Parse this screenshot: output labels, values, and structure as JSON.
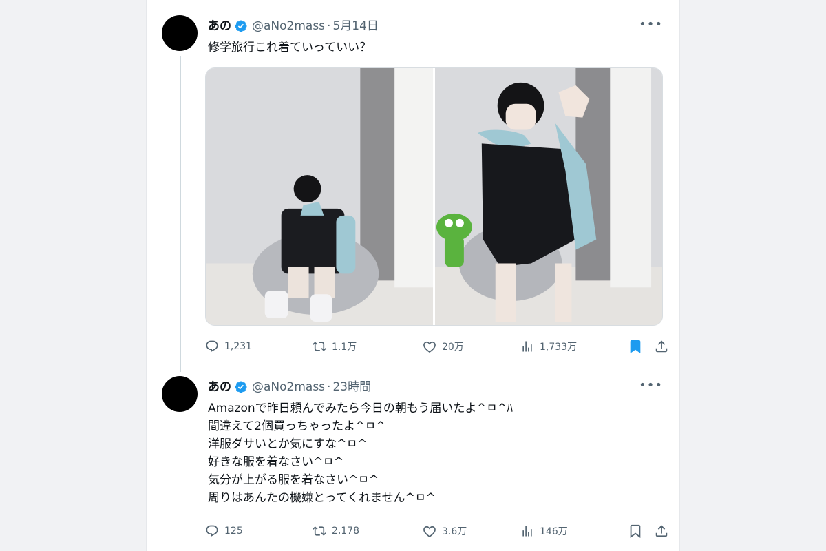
{
  "colors": {
    "verified": "#1d9bf0",
    "bookmarked": "#1d9bf0",
    "muted": "#536471"
  },
  "tweets": [
    {
      "author": {
        "name": "あの",
        "handle": "@aNo2mass"
      },
      "date": "5月14日",
      "text": "修学旅行これ着ていっていい？",
      "more": "•••",
      "stats": {
        "replies": "1,231",
        "retweets": "1.1万",
        "likes": "20万",
        "views": "1,733万"
      },
      "bookmarked": true,
      "icons": [
        "reply-icon",
        "retweet-icon",
        "like-icon",
        "views-icon",
        "bookmark-icon",
        "share-icon"
      ]
    },
    {
      "author": {
        "name": "あの",
        "handle": "@aNo2mass"
      },
      "date": "23時間",
      "text": "Amazonで昨日頼んでみたら今日の朝もう届いたよ^ㅁ^ﾊ\n間違えて2個買っちゃったよ^ㅁ^\n洋服ダサいとか気にすな^ㅁ^\n好きな服を着なさい^ㅁ^\n気分が上がる服を着なさい^ㅁ^\n周りはあんたの機嫌とってくれません^ㅁ^",
      "more": "•••",
      "stats": {
        "replies": "125",
        "retweets": "2,178",
        "likes": "3.6万",
        "views": "146万"
      },
      "bookmarked": false,
      "icons": [
        "reply-icon",
        "retweet-icon",
        "like-icon",
        "views-icon",
        "bookmark-icon",
        "share-icon"
      ]
    }
  ]
}
